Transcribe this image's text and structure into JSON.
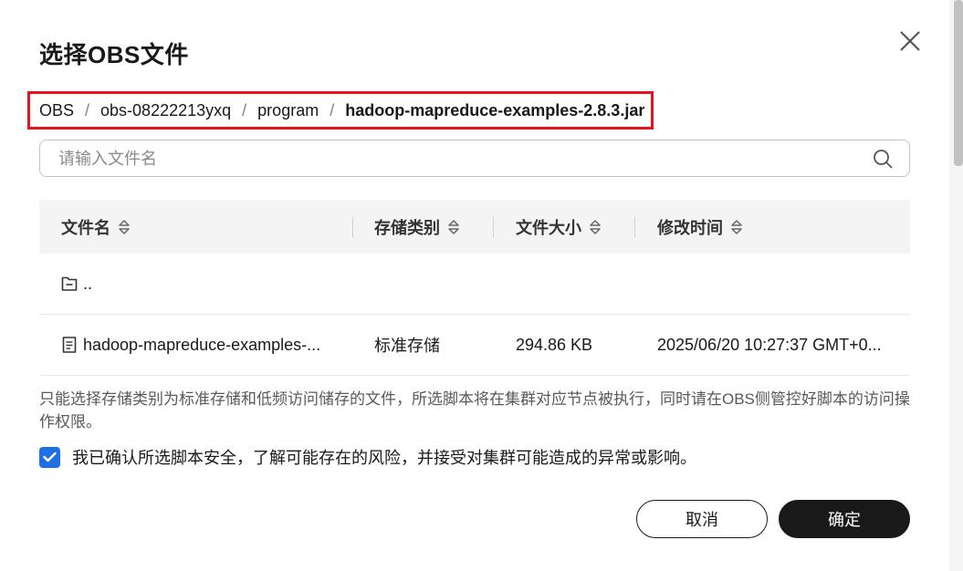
{
  "dialog": {
    "title": "选择OBS文件"
  },
  "breadcrumb": {
    "items": [
      "OBS",
      "obs-08222213yxq",
      "program"
    ],
    "current": "hadoop-mapreduce-examples-2.8.3.jar",
    "separator": "/"
  },
  "search": {
    "placeholder": "请输入文件名",
    "value": ""
  },
  "table": {
    "columns": [
      "文件名",
      "存储类别",
      "文件大小",
      "修改时间"
    ],
    "rows": [
      {
        "icon": "folder-up-icon",
        "name": "..",
        "storage": "",
        "size": "",
        "modified": ""
      },
      {
        "icon": "file-icon",
        "name": "hadoop-mapreduce-examples-...",
        "storage": "标准存储",
        "size": "294.86 KB",
        "modified": "2025/06/20 10:27:37 GMT+0..."
      }
    ]
  },
  "note": "只能选择存储类别为标准存储和低频访问储存的文件，所选脚本将在集群对应节点被执行，同时请在OBS侧管控好脚本的访问操作权限。",
  "agreement": {
    "checked": true,
    "label": "我已确认所选脚本安全，了解可能存在的风险，并接受对集群可能造成的异常或影响。"
  },
  "buttons": {
    "cancel": "取消",
    "confirm": "确定"
  },
  "colors": {
    "highlight_border": "#e5141c",
    "checkbox": "#1f6fe6",
    "primary_button": "#191919"
  }
}
